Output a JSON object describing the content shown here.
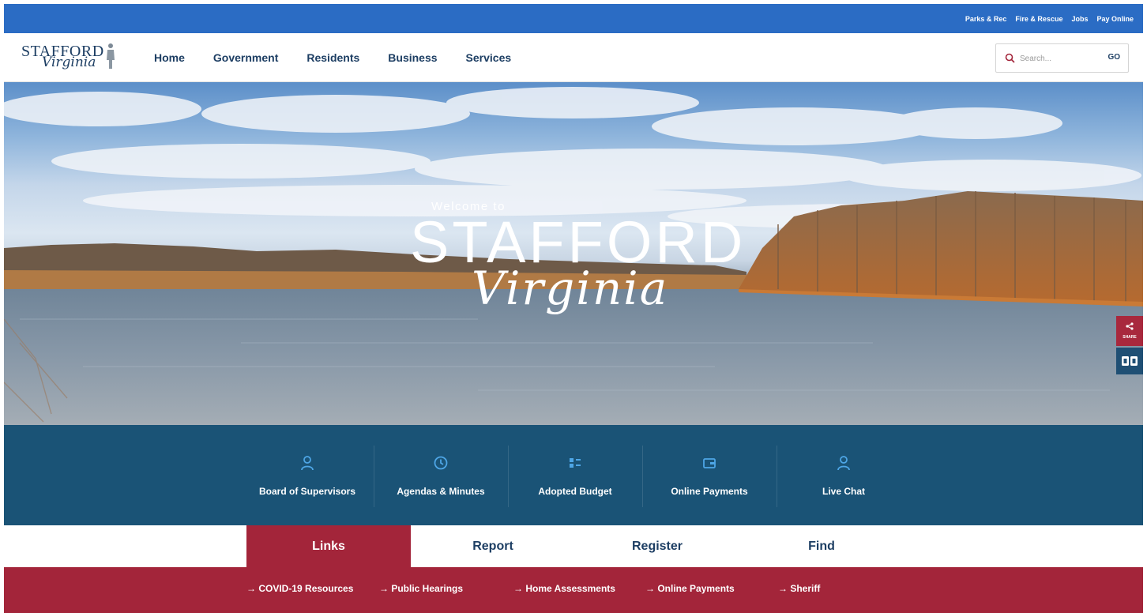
{
  "utility_nav": [
    "Parks & Rec",
    "Fire & Rescue",
    "Jobs",
    "Pay Online"
  ],
  "logo": {
    "main": "STAFFORD",
    "script": "Virginia"
  },
  "main_nav": [
    "Home",
    "Government",
    "Residents",
    "Business",
    "Services"
  ],
  "search": {
    "placeholder": "Search...",
    "go_label": "GO"
  },
  "hero": {
    "welcome": "Welcome to",
    "title": "STAFFORD",
    "subtitle": "Virginia"
  },
  "side_tools": {
    "share_label": "SHARE"
  },
  "quick_links": [
    {
      "label": "Board of Supervisors",
      "icon": "person-icon"
    },
    {
      "label": "Agendas & Minutes",
      "icon": "clock-icon"
    },
    {
      "label": "Adopted Budget",
      "icon": "budget-icon"
    },
    {
      "label": "Online Payments",
      "icon": "wallet-icon"
    },
    {
      "label": "Live Chat",
      "icon": "person-icon"
    }
  ],
  "tabs": [
    "Links",
    "Report",
    "Register",
    "Find"
  ],
  "active_tab": "Links",
  "tab_links": [
    "COVID-19 Resources",
    "Public Hearings",
    "Home Assessments",
    "Online Payments",
    "Sheriff"
  ],
  "colors": {
    "utility": "#2b6cc4",
    "navy": "#1d3e63",
    "quick_band": "#1a5376",
    "crimson": "#a3253a"
  }
}
